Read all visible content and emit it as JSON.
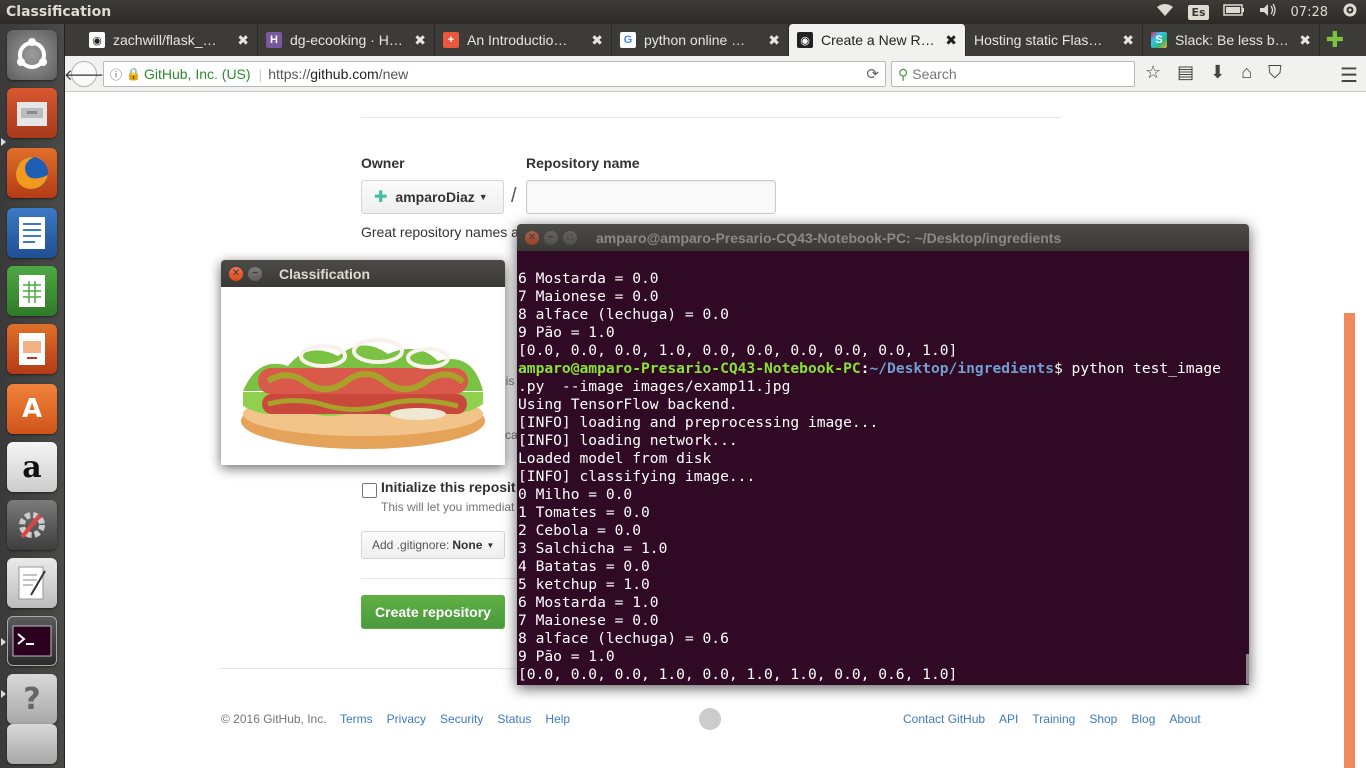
{
  "panel": {
    "app_title": "Classification",
    "keyboard_layout": "Es",
    "clock": "07:28"
  },
  "tabs": [
    {
      "label": "zachwill/flask_…",
      "icon": "github-icon",
      "active": false
    },
    {
      "label": "dg-ecooking · H…",
      "icon": "heroku-icon",
      "active": false
    },
    {
      "label": "An Introductio…",
      "icon": "plus-icon",
      "active": false
    },
    {
      "label": "python online …",
      "icon": "google-icon",
      "active": false
    },
    {
      "label": "Create a New R…",
      "icon": "github-icon",
      "active": true
    },
    {
      "label": "Hosting static Flas…",
      "icon": "none",
      "active": false
    },
    {
      "label": "Slack: Be less b…",
      "icon": "slack-icon",
      "active": false
    }
  ],
  "nav": {
    "identity": "GitHub, Inc. (US)",
    "url_scheme": "https://",
    "url_host": "github.com",
    "url_path": "/new",
    "search_placeholder": "Search"
  },
  "github": {
    "owner_label": "Owner",
    "repo_label": "Repository name",
    "owner_name": "amparoDiaz",
    "slash": "/",
    "hint_partial": "Great repository names a",
    "hint_fragment_1": "his",
    "hint_fragment_2": "ca",
    "init_label": "Initialize this reposit",
    "init_desc": "This will let you immediat",
    "gitignore_prefix": "Add .gitignore:",
    "gitignore_value": "None",
    "create_button": "Create repository",
    "footer_copy": "© 2016 GitHub, Inc.",
    "footer_left": [
      "Terms",
      "Privacy",
      "Security",
      "Status",
      "Help"
    ],
    "footer_right": [
      "Contact GitHub",
      "API",
      "Training",
      "Shop",
      "Blog",
      "About"
    ]
  },
  "classification_window": {
    "title": "Classification"
  },
  "terminal": {
    "title": "amparo@amparo-Presario-CQ43-Notebook-PC: ~/Desktop/ingredients",
    "lines_before": [
      "6 Mostarda = 0.0",
      "7 Maionese = 0.0",
      "8 alface (lechuga) = 0.0",
      "9 Pão = 1.0",
      "[0.0, 0.0, 0.0, 1.0, 0.0, 0.0, 0.0, 0.0, 0.0, 1.0]"
    ],
    "prompt_user": "amparo@amparo-Presario-CQ43-Notebook-PC",
    "prompt_path": "~/Desktop/ingredients",
    "command": "$ python test_image",
    "command_cont": ".py  --image images/examp11.jpg",
    "lines_after": [
      "Using TensorFlow backend.",
      "[INFO] loading and preprocessing image...",
      "[INFO] loading network...",
      "Loaded model from disk",
      "[INFO] classifying image...",
      "0 Milho = 0.0",
      "1 Tomates = 0.0",
      "2 Cebola = 0.0",
      "3 Salchicha = 1.0",
      "4 Batatas = 0.0",
      "5 ketchup = 1.0",
      "6 Mostarda = 1.0",
      "7 Maionese = 0.0",
      "8 alface (lechuga) = 0.6",
      "9 Pão = 1.0",
      "[0.0, 0.0, 0.0, 1.0, 0.0, 1.0, 1.0, 0.0, 0.6, 1.0]"
    ]
  }
}
